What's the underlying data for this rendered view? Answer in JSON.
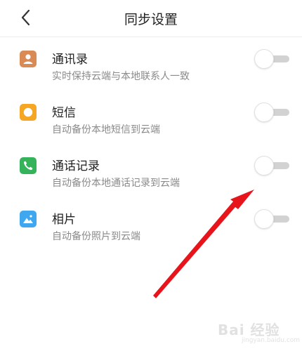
{
  "header": {
    "title": "同步设置",
    "back_icon": "chevron-left-icon"
  },
  "settings": [
    {
      "title": "通讯录",
      "description": "实时保持云端与本地联系人一致",
      "icon": "contacts-icon",
      "icon_color": "#d98a55",
      "enabled": false
    },
    {
      "title": "短信",
      "description": "自动备份本地短信到云端",
      "icon": "sms-icon",
      "icon_color": "#f5a623",
      "enabled": false
    },
    {
      "title": "通话记录",
      "description": "自动备份本地通话记录到云端",
      "icon": "phone-icon",
      "icon_color": "#34b35a",
      "enabled": false
    },
    {
      "title": "相片",
      "description": "自动备份照片到云端",
      "icon": "photo-icon",
      "icon_color": "#3ea7f0",
      "enabled": false
    }
  ],
  "annotation": {
    "color": "#e8141b"
  },
  "watermark": {
    "text": "Bai 经验",
    "subtext": "jingyan.baidu.com"
  }
}
